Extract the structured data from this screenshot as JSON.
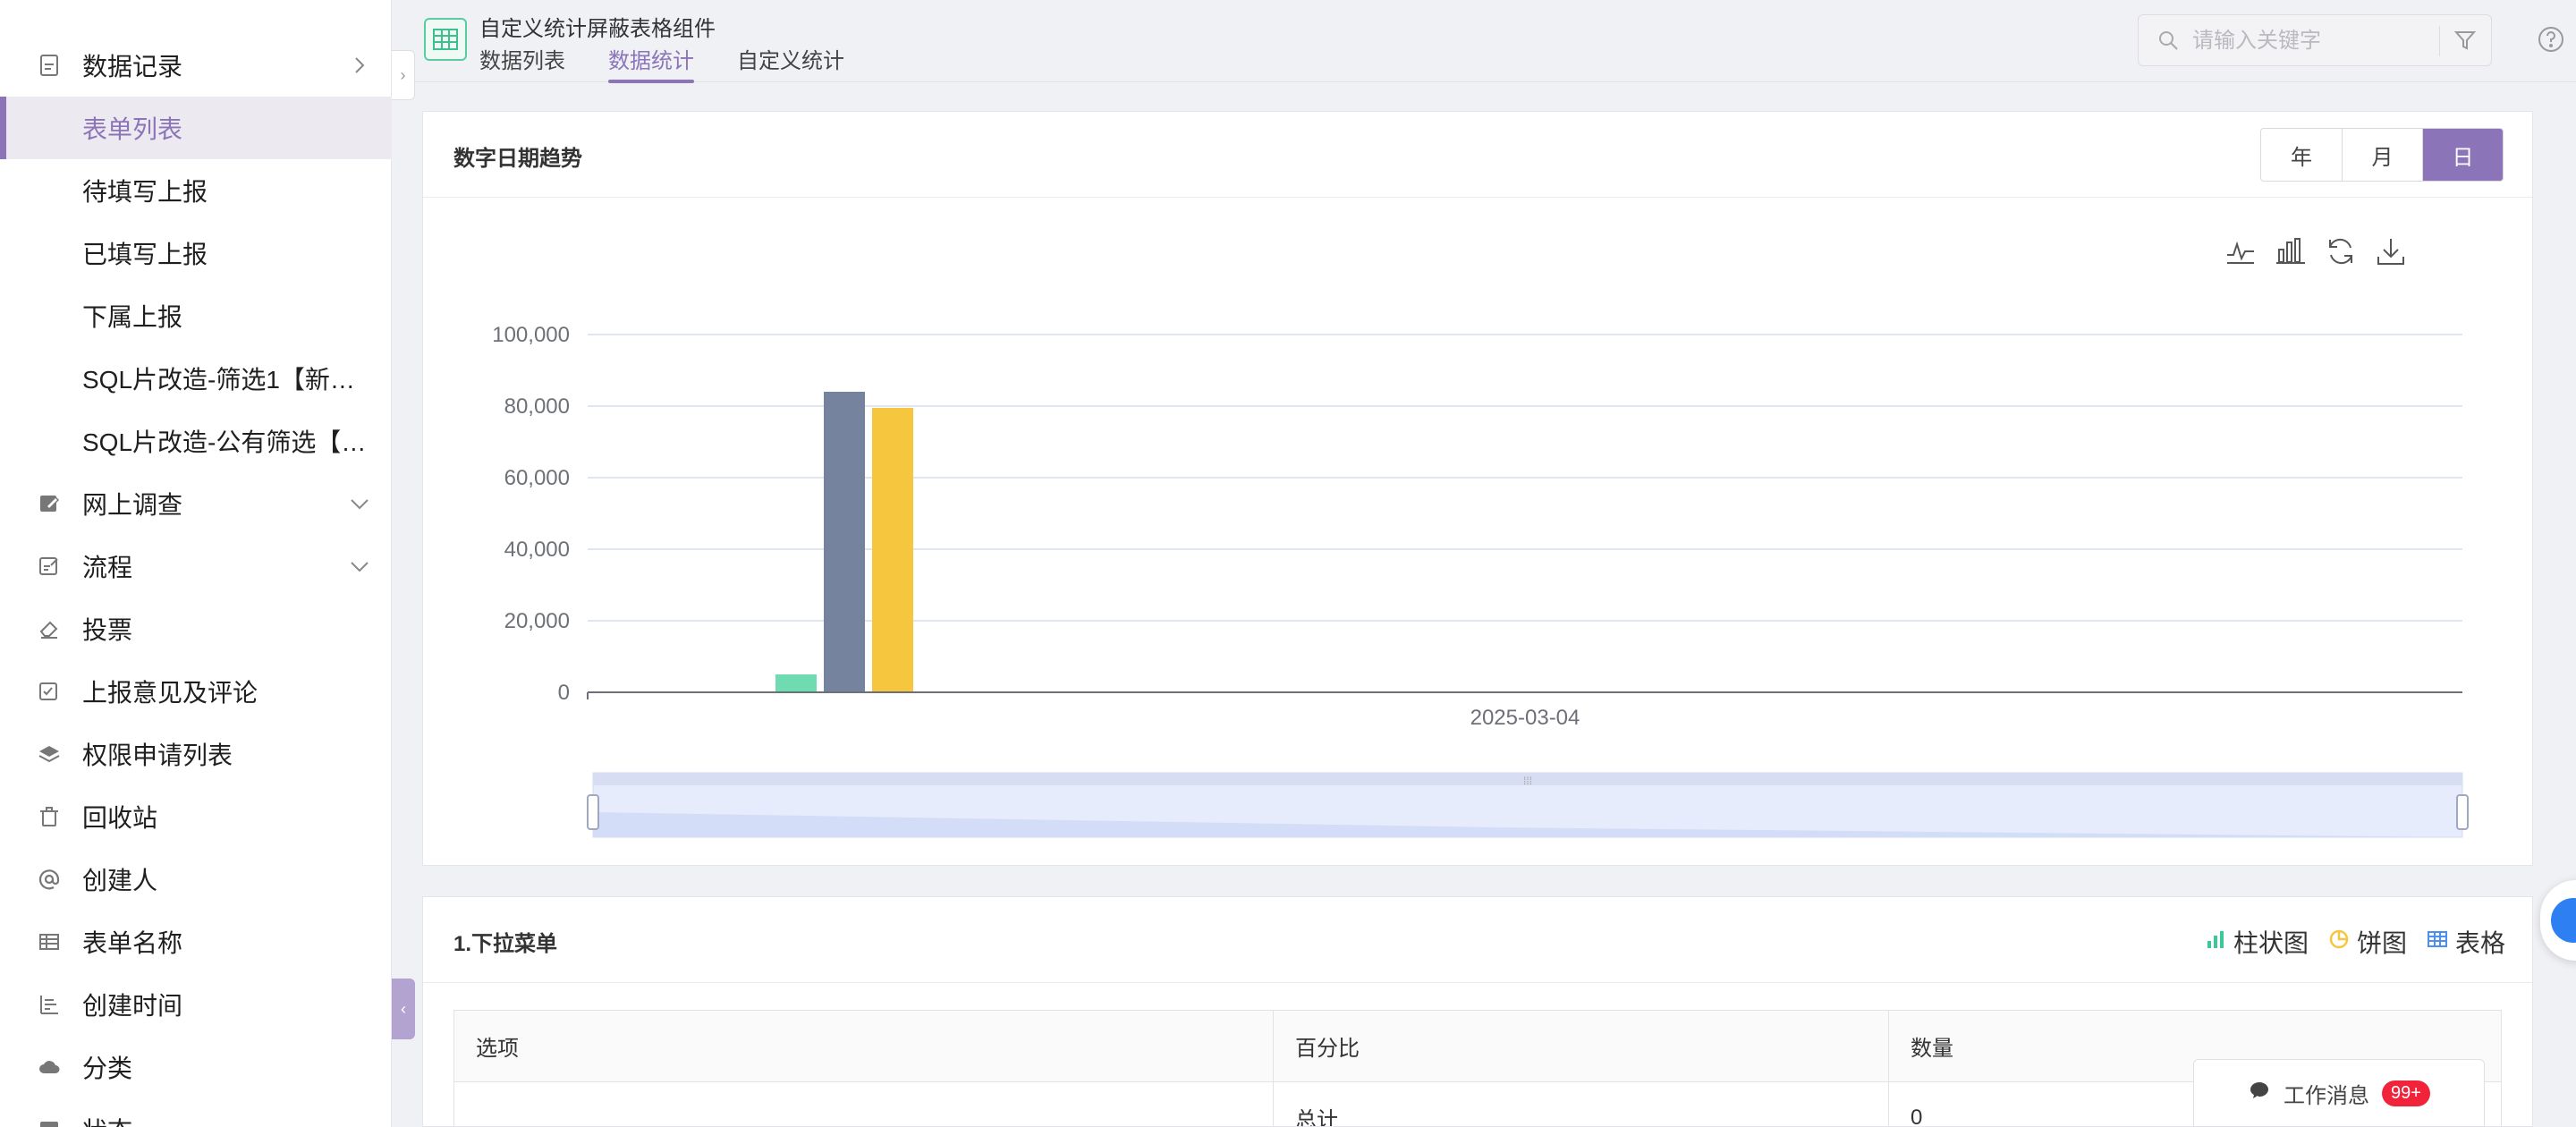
{
  "sidebar": {
    "items": [
      {
        "label": "数据记录",
        "icon": "doc-icon",
        "arrow": "right"
      },
      {
        "label": "表单列表",
        "active": true
      },
      {
        "label": "待填写上报"
      },
      {
        "label": "已填写上报"
      },
      {
        "label": "下属上报"
      },
      {
        "label": "SQL片改造-筛选1【新…"
      },
      {
        "label": "SQL片改造-公有筛选【…"
      },
      {
        "label": "网上调查",
        "icon": "edit-icon",
        "arrow": "down"
      },
      {
        "label": "流程",
        "icon": "flow-icon",
        "arrow": "down"
      },
      {
        "label": "投票",
        "icon": "eraser-icon"
      },
      {
        "label": "上报意见及评论",
        "icon": "comment-check-icon"
      },
      {
        "label": "权限申请列表",
        "icon": "layers-icon"
      },
      {
        "label": "回收站",
        "icon": "trash-icon"
      },
      {
        "label": "创建人",
        "icon": "at-icon"
      },
      {
        "label": "表单名称",
        "icon": "table-icon"
      },
      {
        "label": "创建时间",
        "icon": "bar-list-icon"
      },
      {
        "label": "分类",
        "icon": "cloud-icon"
      },
      {
        "label": "状态",
        "icon": "check-square-icon"
      }
    ]
  },
  "header": {
    "app_title": "自定义统计屏蔽表格组件",
    "tabs": [
      "数据列表",
      "数据统计",
      "自定义统计"
    ],
    "active_tab": 1,
    "search_placeholder": "请输入关键字"
  },
  "trend_card": {
    "title": "数字日期趋势",
    "periods": [
      "年",
      "月",
      "日"
    ],
    "active_period": "日"
  },
  "chart_data": {
    "type": "bar",
    "categories": [
      "2025-03-04"
    ],
    "series": [
      {
        "values": [
          5000
        ],
        "color": "#6fdbb0"
      },
      {
        "values": [
          84000
        ],
        "color": "#76839e"
      },
      {
        "values": [
          79500
        ],
        "color": "#f6c73e"
      }
    ],
    "ylim": [
      0,
      100000
    ],
    "yticks": [
      "0",
      "20,000",
      "40,000",
      "60,000",
      "80,000",
      "100,000"
    ],
    "xlabel": "",
    "ylabel": "",
    "grid": true
  },
  "dropdown_card": {
    "title": "1.下拉菜单",
    "view_options": [
      "柱状图",
      "饼图",
      "表格"
    ],
    "table": {
      "headers": [
        "选项",
        "百分比",
        "数量"
      ],
      "rows": [
        [
          "",
          "总计",
          "0"
        ]
      ]
    }
  },
  "messages": {
    "label": "工作消息",
    "badge": "99+"
  },
  "colors": {
    "accent": "#8c74b8",
    "green": "#6fdbb0",
    "gray": "#76839e",
    "yellow": "#f6c73e"
  }
}
